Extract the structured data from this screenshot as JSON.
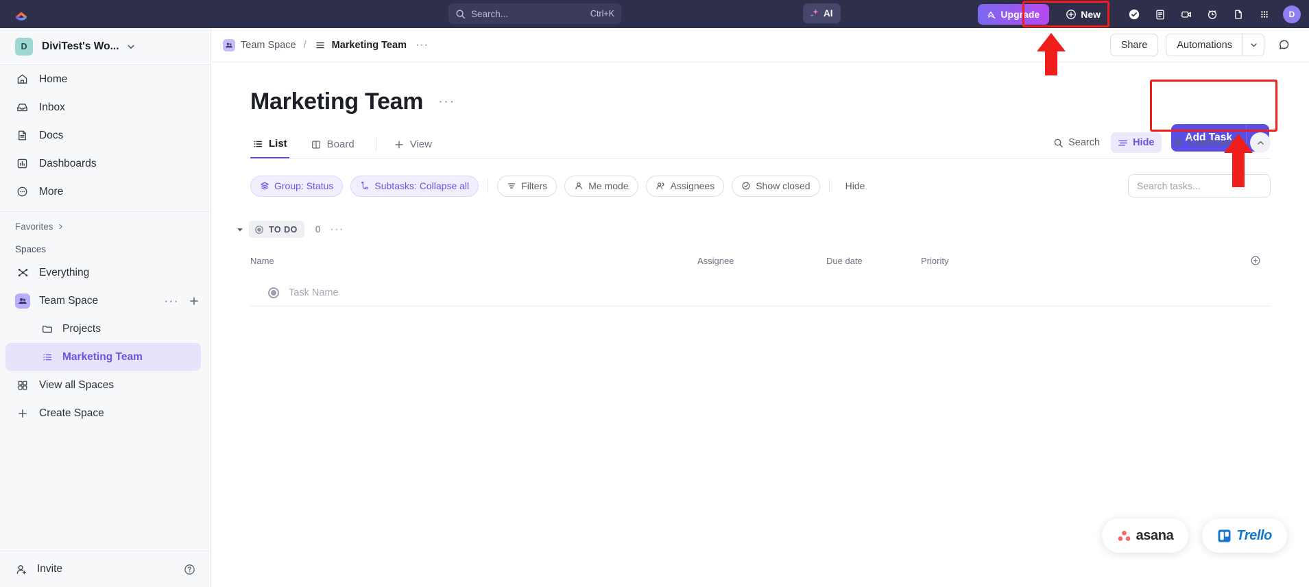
{
  "topbar": {
    "logo_icon": "clickup-logo-icon",
    "search": {
      "icon": "search-icon",
      "placeholder": "Search...",
      "shortcut": "Ctrl+K"
    },
    "ai_button": {
      "icon": "sparkle-icon",
      "label": "AI"
    },
    "upgrade_button": {
      "icon": "rocket-icon",
      "label": "Upgrade"
    },
    "new_button": {
      "icon": "plus-circle-icon",
      "label": "New"
    },
    "icons": [
      {
        "name": "check-circle-icon"
      },
      {
        "name": "clipboard-icon"
      },
      {
        "name": "video-camera-icon"
      },
      {
        "name": "alarm-clock-icon"
      },
      {
        "name": "document-icon"
      },
      {
        "name": "app-grid-icon"
      }
    ],
    "avatar": {
      "initial": "D"
    },
    "accent_purple": "#7b68ee",
    "bar_bg": "#2e2f4a"
  },
  "sidebar": {
    "workspace": {
      "initial": "D",
      "name": "DiviTest's Wo...",
      "chevron_icon": "chevron-down-icon"
    },
    "nav": [
      {
        "label": "Home",
        "icon": "home-icon"
      },
      {
        "label": "Inbox",
        "icon": "inbox-icon"
      },
      {
        "label": "Docs",
        "icon": "docs-icon"
      },
      {
        "label": "Dashboards",
        "icon": "dashboards-icon"
      },
      {
        "label": "More",
        "icon": "more-circle-icon"
      }
    ],
    "favorites": {
      "label": "Favorites",
      "chevron_icon": "chevron-right-icon"
    },
    "spaces_label": "Spaces",
    "spaces": [
      {
        "label": "Everything",
        "icon": "everything-icon"
      },
      {
        "label": "Team Space",
        "icon": "team-space-icon",
        "actions": [
          "ellipsis-icon",
          "plus-icon"
        ]
      }
    ],
    "space_children": [
      {
        "label": "Projects",
        "icon": "folder-icon",
        "active": false
      },
      {
        "label": "Marketing Team",
        "icon": "list-icon",
        "active": true
      }
    ],
    "footer_links": [
      {
        "label": "View all Spaces",
        "icon": "grid-squares-icon"
      },
      {
        "label": "Create Space",
        "icon": "plus-icon"
      }
    ],
    "bottom": {
      "invite_label": "Invite",
      "invite_icon": "user-plus-icon",
      "help_icon": "help-circle-icon"
    },
    "active_color": "#6a55e6"
  },
  "breadcrumb": {
    "items": [
      {
        "label": "Team Space",
        "icon": "team-space-icon",
        "current": false
      },
      {
        "label": "Marketing Team",
        "icon": "list-icon",
        "current": true
      }
    ],
    "separator": "/",
    "dots": "···",
    "share_label": "Share",
    "automations_label": "Automations",
    "automations_chevron": "chevron-down-icon",
    "search_icon": "comment-search-icon"
  },
  "page": {
    "title": "Marketing Team",
    "title_dots": "···",
    "add_task": {
      "label": "Add Task",
      "chevron_icon": "chevron-down-icon",
      "color": "#5b4ee5"
    }
  },
  "view_tabs": {
    "tabs": [
      {
        "label": "List",
        "icon": "list-icon",
        "active": true
      },
      {
        "label": "Board",
        "icon": "board-icon",
        "active": false
      }
    ],
    "add_view": {
      "label": "View",
      "icon": "plus-icon"
    },
    "right_actions": [
      {
        "label": "Search",
        "icon": "search-icon",
        "style": "plain"
      },
      {
        "label": "Hide",
        "icon": "sliders-icon",
        "style": "purple"
      },
      {
        "label": "Customize",
        "icon": "gear-icon",
        "style": "plain"
      }
    ],
    "collapse_icon": "chevron-up-icon"
  },
  "filter_bar": {
    "chips": [
      {
        "label": "Group: Status",
        "icon": "layers-icon",
        "style": "purple"
      },
      {
        "label": "Subtasks: Collapse all",
        "icon": "subtask-icon",
        "style": "purple"
      },
      {
        "label": "Filters",
        "icon": "filter-icon",
        "style": "plain"
      },
      {
        "label": "Me mode",
        "icon": "person-icon",
        "style": "plain"
      },
      {
        "label": "Assignees",
        "icon": "people-icon",
        "style": "plain"
      },
      {
        "label": "Show closed",
        "icon": "check-circle-icon",
        "style": "plain"
      }
    ],
    "hide_label": "Hide",
    "search_tasks_placeholder": "Search tasks..."
  },
  "task_group": {
    "caret_icon": "caret-down-icon",
    "status_icon": "status-circle-icon",
    "status_label": "TO DO",
    "count": "0",
    "dots": "···"
  },
  "table": {
    "columns": [
      "Name",
      "Assignee",
      "Due date",
      "Priority"
    ],
    "add_column_icon": "plus-circle-icon",
    "rows": [
      {
        "status_icon": "status-circle-icon",
        "name": "Task Name"
      }
    ]
  },
  "widgets": [
    {
      "name": "asana",
      "label": "asana",
      "icon": "asana-dots-icon",
      "color": "#f06a6a"
    },
    {
      "name": "trello",
      "label": "Trello",
      "icon": "trello-board-icon",
      "color": "#1476cf"
    }
  ],
  "annotations": {
    "color": "#f01d1d",
    "highlight_boxes": [
      "new-button",
      "add-task-button"
    ],
    "arrows": [
      "arrow-to-new-button",
      "arrow-to-add-task-button"
    ]
  }
}
